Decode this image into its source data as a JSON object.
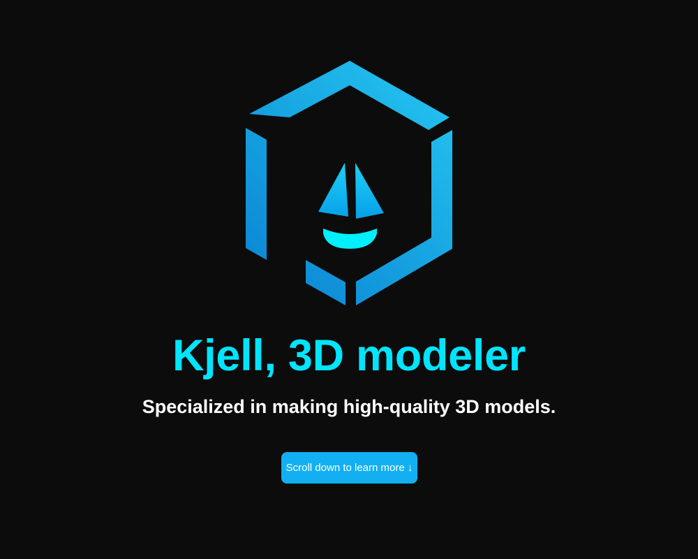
{
  "page": {
    "background": "#0c0c0c"
  },
  "logo": {
    "icon": "hexagon-sailboat-logo",
    "colors": {
      "frame_light": "#24c4f0",
      "frame_dark": "#0b86d4",
      "sail_light": "#1fd0f8",
      "sail_dark": "#06a0e8",
      "hull": "#00f0ff"
    }
  },
  "hero": {
    "title": "Kjell, 3D modeler",
    "title_color": "#00e5ff",
    "subtitle": "Specialized in making high-quality 3D models.",
    "subtitle_color": "#ffffff"
  },
  "cta": {
    "label": "Scroll down to learn more ↓",
    "background": "#12b0f2",
    "text_color": "#ffffff"
  }
}
